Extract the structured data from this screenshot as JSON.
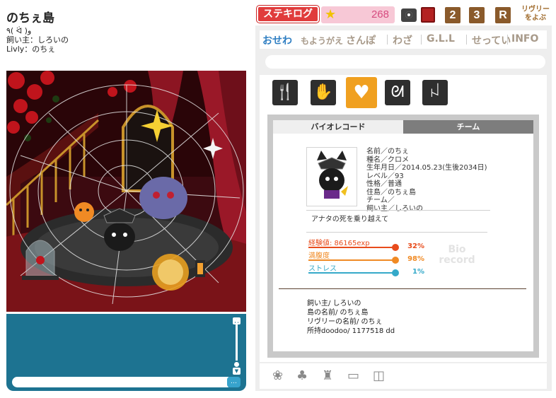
{
  "island": {
    "title": "のちぇ島",
    "emote": "٩( ᐛ )و",
    "owner_line": "飼い主：しろいの",
    "livly_line": "Livly：のちぇ"
  },
  "header": {
    "stekilog_label": "ステキログ",
    "points": "268",
    "tile_2": "2",
    "tile_3": "3",
    "tile_r": "R",
    "call_livly": "リヴリーをよぶ"
  },
  "tabs": {
    "osewa": "おせわ",
    "moyougae": "もようがえ",
    "sanpo": "さんぽ",
    "waza": "わざ",
    "gll": "G.L.L",
    "settei": "せってい",
    "info": "INFO"
  },
  "care_icons": [
    "food-icon",
    "pet-hand-icon",
    "heart-icon",
    "spray-icon",
    "ribbon-icon"
  ],
  "record": {
    "tab_bio": "バイオレコード",
    "tab_team": "チーム",
    "profile": {
      "name": "名前／のちぇ",
      "species": "種名／クロメ",
      "birthday": "生年月日／2014.05.23(生後2034日)",
      "level": "レベル／93",
      "personality": "性格／普通",
      "residence": "住島／のちぇ島",
      "team": "チーム／",
      "owner": "飼い主／しろいの"
    },
    "comment": "アナタの死を乗り越えて",
    "stats": {
      "exp_label": "経験値: 86165exp",
      "exp_pct": "32%",
      "exp_value": 0.32,
      "fullness_label": "満腹度",
      "fullness_pct": "98%",
      "fullness_value": 0.98,
      "stress_label": "ストレス",
      "stress_pct": "1%",
      "stress_value": 0.01
    },
    "stamp": "Bio record",
    "owner_info": {
      "owner": "飼い主/ しろいの",
      "island_name": "島の名前/ のちぇ島",
      "livly_name": "リヴリーの名前/ のちぇ",
      "doodoo": "所持doodoo/ 1177518 dd"
    }
  },
  "colors": {
    "chat_panel": "#1d7391",
    "accent_blue": "#2e7ec2",
    "stekilog_red": "#e03c3c",
    "points_pink": "#f7c8d6",
    "exp_color": "#e84c1c",
    "fullness_color": "#f08a24",
    "stress_color": "#35a9c9"
  }
}
